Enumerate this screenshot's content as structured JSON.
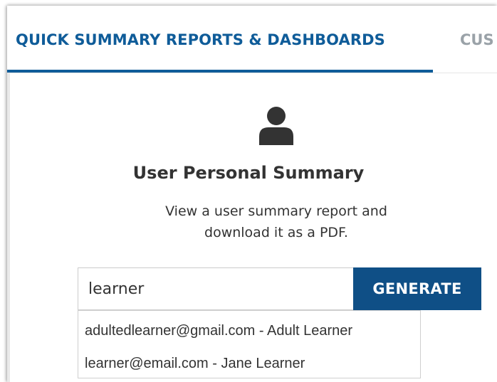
{
  "tabs": {
    "active_label": "QUICK SUMMARY REPORTS & DASHBOARDS",
    "next_label": "CUS"
  },
  "card": {
    "icon": "user-icon",
    "title": "User Personal Summary",
    "description": "View a user summary report and download it as a PDF."
  },
  "search": {
    "value": "learner",
    "button_label": "GENERATE"
  },
  "suggestions": [
    "adultedlearner@gmail.com - Adult Learner",
    "learner@email.com - Jane Learner"
  ],
  "colors": {
    "brand_blue": "#0f5c99",
    "button_blue": "#0f4f86",
    "text": "#333333"
  }
}
